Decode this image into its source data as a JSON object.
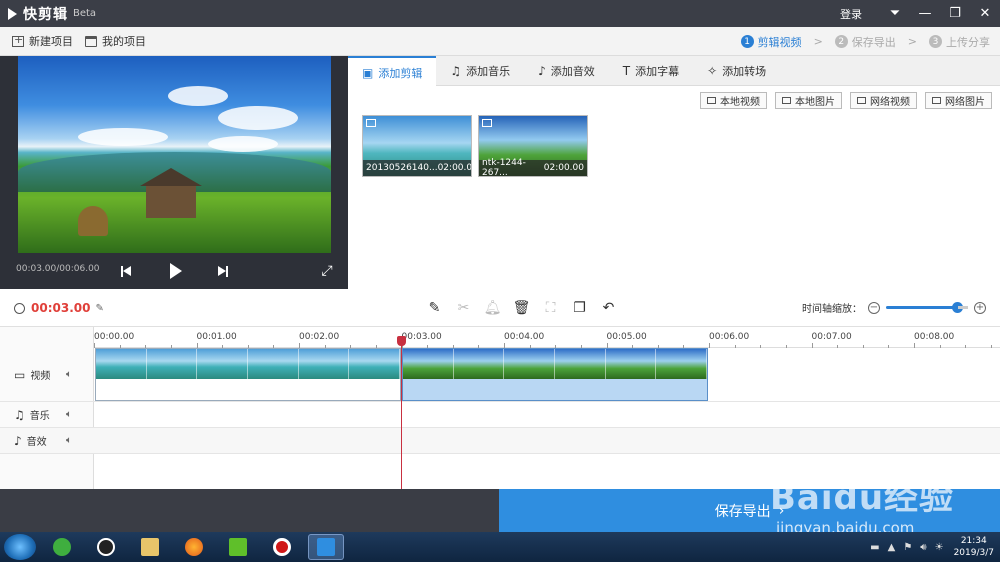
{
  "app": {
    "name": "快剪辑",
    "badge": "Beta",
    "login": "登录"
  },
  "window_controls": {
    "menu": "⏷",
    "minimize": "—",
    "maximize": "❐",
    "close": "✕"
  },
  "toolbar": {
    "new_project": "新建项目",
    "my_projects": "我的项目"
  },
  "steps": [
    {
      "num": "1",
      "label": "剪辑视频"
    },
    {
      "num": "2",
      "label": "保存导出"
    },
    {
      "num": "3",
      "label": "上传分享"
    }
  ],
  "step_separator": ">",
  "preview": {
    "timecode": "00:03.00/00:06.00"
  },
  "tabs": [
    {
      "icon": "▣",
      "label": "添加剪辑"
    },
    {
      "icon": "♫",
      "label": "添加音乐"
    },
    {
      "icon": "♪",
      "label": "添加音效"
    },
    {
      "icon": "T",
      "label": "添加字幕"
    },
    {
      "icon": "✧",
      "label": "添加转场"
    }
  ],
  "source_buttons": [
    "本地视频",
    "本地图片",
    "网络视频",
    "网络图片"
  ],
  "media_clips": [
    {
      "name": "20130526140...",
      "duration": "02:00.00"
    },
    {
      "name": "ntk-1244-267...",
      "duration": "02:00.00"
    }
  ],
  "edit": {
    "current_time": "00:03.00",
    "zoom_label": "时间轴缩放：",
    "zoom_level": 0.8
  },
  "ruler_ticks": [
    "00:00.00",
    "00:01.00",
    "00:02.00",
    "00:03.00",
    "00:04.00",
    "00:05.00",
    "00:06.00",
    "00:07.00",
    "00:08.00"
  ],
  "tracks": {
    "video": "视频",
    "music": "音乐",
    "sfx": "音效"
  },
  "export": {
    "label": "保存导出",
    "arrow": "›"
  },
  "taskbar": {
    "time": "21:34",
    "date": "2019/3/7"
  },
  "watermark": {
    "brand": "Baidu经验",
    "url": "jingyan.baidu.com"
  }
}
